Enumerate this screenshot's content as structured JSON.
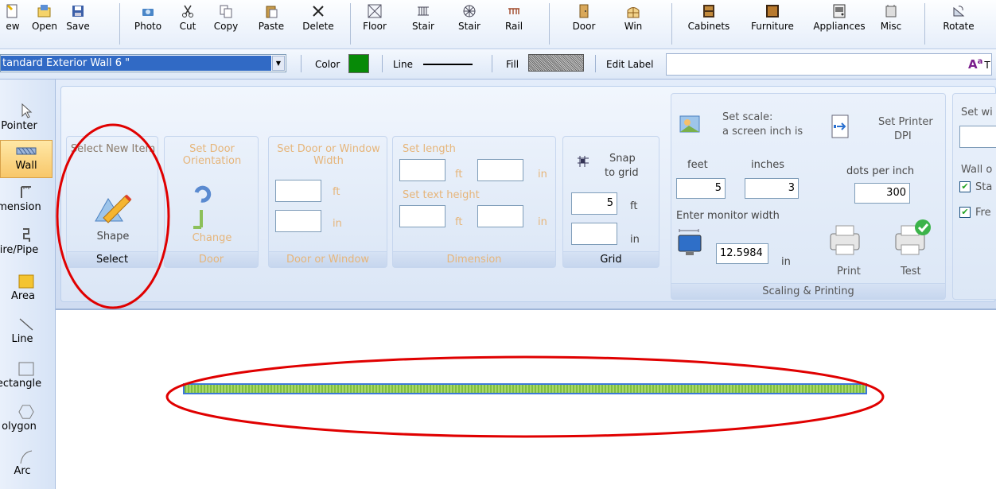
{
  "toolbar": {
    "new": "ew",
    "open": "Open",
    "save": "Save",
    "photo": "Photo",
    "cut": "Cut",
    "copy": "Copy",
    "paste": "Paste",
    "delete": "Delete",
    "floor": "Floor",
    "stair1": "Stair",
    "stair2": "Stair",
    "rail": "Rail",
    "door": "Door",
    "win": "Win",
    "cabinets": "Cabinets",
    "furniture": "Furniture",
    "appliances": "Appliances",
    "misc": "Misc",
    "rotate": "Rotate"
  },
  "bar2": {
    "wall_type": "tandard Exterior Wall 6 \"",
    "color_label": "Color",
    "color_value": "#078a07",
    "line_label": "Line",
    "fill_label": "Fill",
    "edit_label": "Edit Label",
    "text_btn": "T"
  },
  "palette": {
    "pointer": "Pointer",
    "wall": "Wall",
    "dimension": "mension",
    "wirepipe": "ire/Pipe",
    "area": "Area",
    "line": "Line",
    "rectangle": "ectangle",
    "polygon": "olygon",
    "arc": "Arc"
  },
  "ribbon": {
    "select": {
      "heading": "Select New Item",
      "shape": "Shape",
      "title": "Select"
    },
    "door": {
      "heading": "Set Door Orientation",
      "change": "Change",
      "title": "Door"
    },
    "doorwin": {
      "heading": "Set Door or Window Width",
      "ft": "ft",
      "in": "in",
      "title": "Door or Window"
    },
    "dimension": {
      "set_length": "Set length",
      "ft": "ft",
      "in": "in",
      "set_text_height": "Set text height",
      "ft2": "ft",
      "in2": "in",
      "title": "Dimension"
    },
    "grid": {
      "snap": "Snap",
      "to_grid": "to grid",
      "value_ft": "5",
      "ft": "ft",
      "in": "in",
      "title": "Grid"
    },
    "scaling": {
      "set_scale": "Set scale:",
      "screen_inch": "a screen inch is",
      "set_printer": "Set Printer",
      "dpi": "DPI",
      "feet": "feet",
      "inches": "inches",
      "dots_per_inch": "dots per inch",
      "feet_value": "5",
      "inches_value": "3",
      "dpi_value": "300",
      "enter_monitor_width": "Enter monitor width",
      "monitor_value": "12.5984",
      "in": "in",
      "print": "Print",
      "test": "Test",
      "title": "Scaling & Printing"
    },
    "right": {
      "set_wi": "Set wi",
      "wall_o": "Wall o",
      "sta": "Sta",
      "fre": "Fre"
    }
  },
  "colors": {
    "accent": "#316ac5",
    "annotation": "#e00000",
    "wall_fill": "#8fcc52",
    "wall_border": "#3c78d8"
  }
}
